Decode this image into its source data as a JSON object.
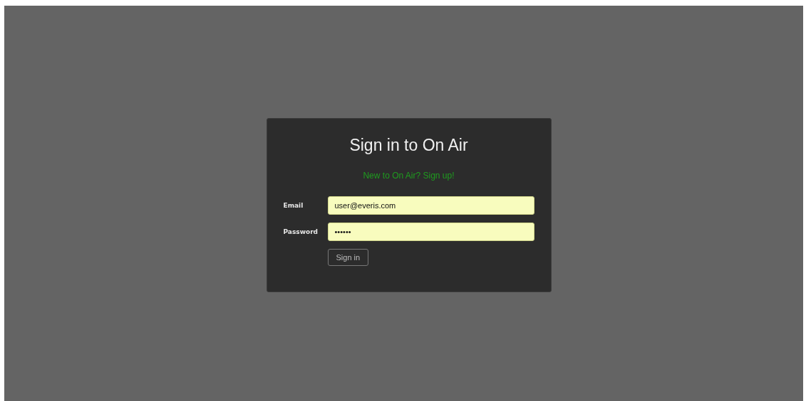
{
  "dialog": {
    "title": "Sign in to On Air",
    "signup_link": "New to On Air? Sign up!",
    "fields": [
      {
        "label": "Email",
        "value": "user@everis.com"
      },
      {
        "label": "Password",
        "value": "••••••"
      }
    ],
    "buttons": [
      "Sign in"
    ]
  }
}
